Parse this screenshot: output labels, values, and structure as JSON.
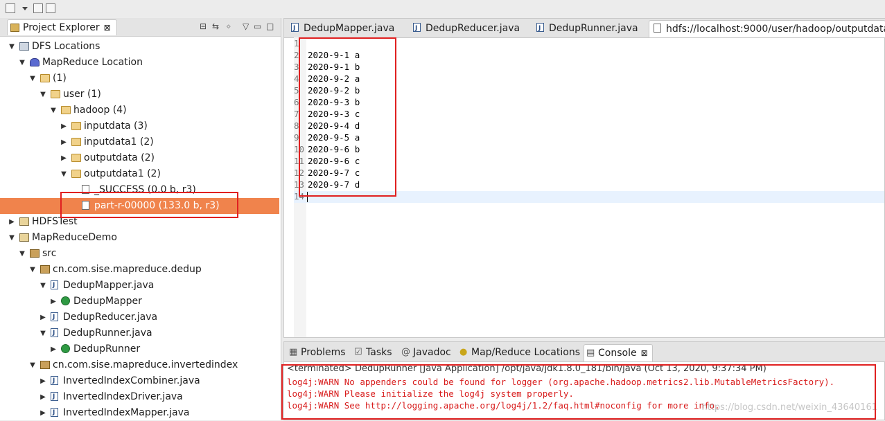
{
  "toolbar": {
    "icons": [
      "new-wizard-icon",
      "save-icon",
      "save-all-icon"
    ]
  },
  "project_explorer": {
    "title": "Project Explorer",
    "close_glyph": "⊠",
    "tree": [
      {
        "label": "DFS Locations",
        "depth": 0,
        "toggle": "open",
        "icon": "dfs-icon"
      },
      {
        "label": "MapReduce Location",
        "depth": 1,
        "toggle": "open",
        "icon": "elephant-icon"
      },
      {
        "label": "(1)",
        "depth": 2,
        "toggle": "open",
        "icon": "folder-icon"
      },
      {
        "label": "user (1)",
        "depth": 3,
        "toggle": "open",
        "icon": "folder-icon"
      },
      {
        "label": "hadoop (4)",
        "depth": 4,
        "toggle": "open",
        "icon": "folder-icon"
      },
      {
        "label": "inputdata (3)",
        "depth": 5,
        "toggle": "closed",
        "icon": "folder-icon"
      },
      {
        "label": "inputdata1 (2)",
        "depth": 5,
        "toggle": "closed",
        "icon": "folder-icon"
      },
      {
        "label": "outputdata (2)",
        "depth": 5,
        "toggle": "closed",
        "icon": "folder-icon"
      },
      {
        "label": "outputdata1 (2)",
        "depth": 5,
        "toggle": "open",
        "icon": "folder-icon"
      },
      {
        "label": "_SUCCESS (0.0 b, r3)",
        "depth": 6,
        "toggle": "none",
        "icon": "file-icon"
      },
      {
        "label": "part-r-00000 (133.0 b, r3)",
        "depth": 6,
        "toggle": "none",
        "icon": "file-icon",
        "selected": true
      },
      {
        "label": "HDFSTest",
        "depth": 0,
        "toggle": "closed",
        "icon": "project-icon"
      },
      {
        "label": "MapReduceDemo",
        "depth": 0,
        "toggle": "open",
        "icon": "project-icon"
      },
      {
        "label": "src",
        "depth": 1,
        "toggle": "open",
        "icon": "package-folder-icon"
      },
      {
        "label": "cn.com.sise.mapreduce.dedup",
        "depth": 2,
        "toggle": "open",
        "icon": "package-icon"
      },
      {
        "label": "DedupMapper.java",
        "depth": 3,
        "toggle": "open",
        "icon": "java-file-icon"
      },
      {
        "label": "DedupMapper",
        "depth": 4,
        "toggle": "closed",
        "icon": "class-icon"
      },
      {
        "label": "DedupReducer.java",
        "depth": 3,
        "toggle": "closed",
        "icon": "java-file-icon"
      },
      {
        "label": "DedupRunner.java",
        "depth": 3,
        "toggle": "open",
        "icon": "java-file-icon"
      },
      {
        "label": "DedupRunner",
        "depth": 4,
        "toggle": "closed",
        "icon": "class-icon"
      },
      {
        "label": "cn.com.sise.mapreduce.invertedindex",
        "depth": 2,
        "toggle": "open",
        "icon": "package-icon"
      },
      {
        "label": "InvertedIndexCombiner.java",
        "depth": 3,
        "toggle": "closed",
        "icon": "java-file-icon"
      },
      {
        "label": "InvertedIndexDriver.java",
        "depth": 3,
        "toggle": "closed",
        "icon": "java-file-icon"
      },
      {
        "label": "InvertedIndexMapper.java",
        "depth": 3,
        "toggle": "closed",
        "icon": "java-file-icon"
      }
    ]
  },
  "editor": {
    "tabs": [
      {
        "label": "DedupMapper.java",
        "icon": "java-file-icon",
        "active": false
      },
      {
        "label": "DedupReducer.java",
        "icon": "java-file-icon",
        "active": false
      },
      {
        "label": "DedupRunner.java",
        "icon": "java-file-icon",
        "active": false
      },
      {
        "label": "hdfs://localhost:9000/user/hadoop/outputdata",
        "icon": "file-icon",
        "active": true
      }
    ],
    "lines": [
      {
        "num": "1",
        "text": ""
      },
      {
        "num": "2",
        "text": "2020-9-1 a"
      },
      {
        "num": "3",
        "text": "2020-9-1 b"
      },
      {
        "num": "4",
        "text": "2020-9-2 a"
      },
      {
        "num": "5",
        "text": "2020-9-2 b"
      },
      {
        "num": "6",
        "text": "2020-9-3 b"
      },
      {
        "num": "7",
        "text": "2020-9-3 c"
      },
      {
        "num": "8",
        "text": "2020-9-4 d"
      },
      {
        "num": "9",
        "text": "2020-9-5 a"
      },
      {
        "num": "10",
        "text": "2020-9-6 b"
      },
      {
        "num": "11",
        "text": "2020-9-6 c"
      },
      {
        "num": "12",
        "text": "2020-9-7 c"
      },
      {
        "num": "13",
        "text": "2020-9-7 d"
      },
      {
        "num": "14",
        "text": ""
      }
    ]
  },
  "console": {
    "tabs": [
      {
        "label": "Problems",
        "icon": "problems-icon",
        "active": false
      },
      {
        "label": "Tasks",
        "icon": "tasks-icon",
        "active": false
      },
      {
        "label": "Javadoc",
        "icon": "javadoc-icon",
        "active": false
      },
      {
        "label": "Map/Reduce Locations",
        "icon": "elephant-icon",
        "active": false
      },
      {
        "label": "Console",
        "icon": "console-icon",
        "active": true
      }
    ],
    "close_glyph": "⊠",
    "terminated_line": "<terminated> DedupRunner [Java Application] /opt/java/jdk1.8.0_181/bin/java (Oct 13, 2020, 9:37:34 PM)",
    "warnings": [
      "log4j:WARN No appenders could be found for logger (org.apache.hadoop.metrics2.lib.MutableMetricsFactory).",
      "log4j:WARN Please initialize the log4j system properly.",
      "log4j:WARN See http://logging.apache.org/log4j/1.2/faq.html#noconfig for more info."
    ],
    "watermark": "https://blog.csdn.net/weixin_43640161"
  },
  "colors": {
    "selection": "#f0834c",
    "highlight_box": "#e02020",
    "warn_text": "#d81c1c"
  }
}
